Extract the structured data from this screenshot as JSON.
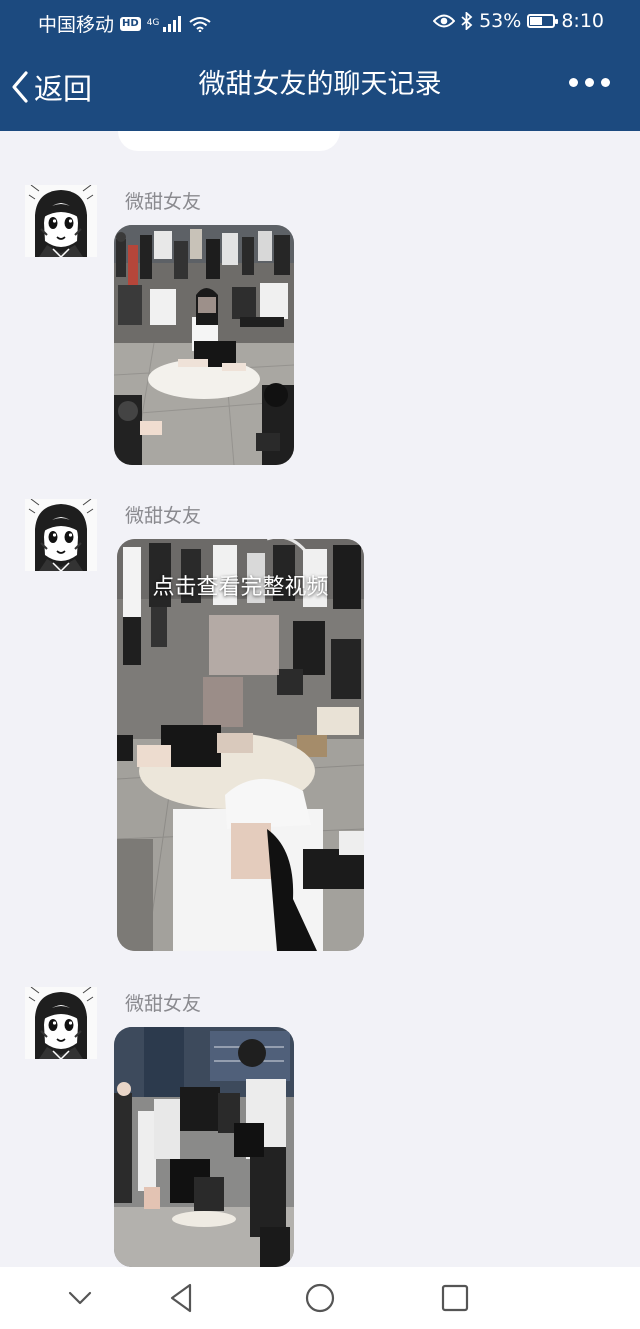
{
  "status_bar": {
    "carrier": "中国移动",
    "hd": "HD",
    "network": "4G",
    "battery_percent": "53%",
    "battery_level": 0.53,
    "time": "8:10"
  },
  "nav": {
    "back_label": "返回",
    "title": "微甜女友的聊天记录"
  },
  "messages": [
    {
      "sender": "微甜女友",
      "type": "image"
    },
    {
      "sender": "微甜女友",
      "type": "video",
      "caption": "点击查看完整视频"
    },
    {
      "sender": "微甜女友",
      "type": "image"
    }
  ],
  "colors": {
    "header_bg": "#1c4a7f",
    "chat_bg": "#f2f2f7",
    "sender_name": "#8a8a8f"
  },
  "icons": {
    "back": "chevron-left-icon",
    "more": "more-dots-icon",
    "eye": "eye-icon",
    "bluetooth": "bluetooth-icon",
    "wifi": "wifi-icon",
    "signal": "signal-icon"
  }
}
